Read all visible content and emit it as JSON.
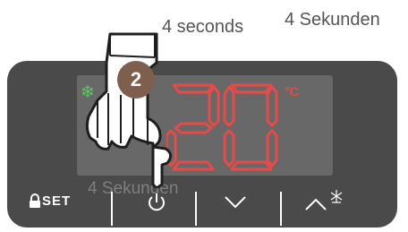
{
  "labels": {
    "duration_en": "4 seconds",
    "duration_de": "4 Sekunden",
    "duration_ghost": "4 Sekunden"
  },
  "display": {
    "temperature": "20",
    "unit": "°C",
    "mode_icon": "snowflake-icon"
  },
  "step": {
    "number": "2"
  },
  "controls": {
    "set_label": "SET",
    "set_icon": "lock-icon",
    "power_icon": "power-icon",
    "down_icon": "chevron-down-icon",
    "up_icon": "chevron-up-icon",
    "defrost_icon": "defrost-icon"
  },
  "colors": {
    "panel": "#4a4a4a",
    "screen": "#686868",
    "segment": "#e84a48",
    "snowflake": "#5cc85c",
    "badge": "#7e5f4e"
  }
}
